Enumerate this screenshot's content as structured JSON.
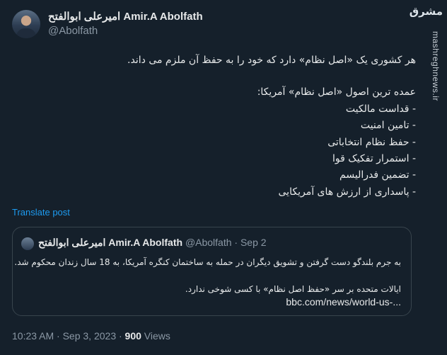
{
  "author": {
    "display_name": "امیرعلی ابوالفتح Amir.A Abolfath",
    "handle": "@Abolfath"
  },
  "tweet": {
    "lines": [
      "هر کشوری یک «اصل نظام» دارد که خود را به حفظ آن ملزم می داند.",
      "",
      "عمده ترین اصول «اصل نظام» آمریکا:",
      "- قداست مالکیت",
      "- تامین امنیت",
      "- حفظ نظام انتخاباتی",
      "- استمرار تفکیک قوا",
      "- تضمین فدرالیسم",
      "- پاسداری از ارزش های آمریکایی"
    ],
    "translate_label": "Translate post"
  },
  "quote": {
    "display_name": "امیرعلی ابوالفتح Amir.A Abolfath",
    "handle_date": "@Abolfath · Sep 2",
    "lines": [
      "به جرم بلندگو دست گرفتن و تشویق دیگران در حمله به ساختمان کنگره آمریکا، به 18 سال زندان محکوم شد.",
      "",
      "ایالات متحده بر سر «حفظ اصل نظام» با کسی شوخی ندارد."
    ],
    "link": "bbc.com/news/world-us-..."
  },
  "footer": {
    "timestamp": "10:23 AM · Sep 3, 2023 · ",
    "views_count": "900",
    "views_label": " Views"
  },
  "watermark": {
    "logo": "مشرق",
    "url": "mashreghnews.ir"
  },
  "colors": {
    "background": "#15202b",
    "text": "#e7e9ea",
    "secondary": "#8b98a5",
    "link": "#1d9bf0",
    "border": "#38444d"
  }
}
